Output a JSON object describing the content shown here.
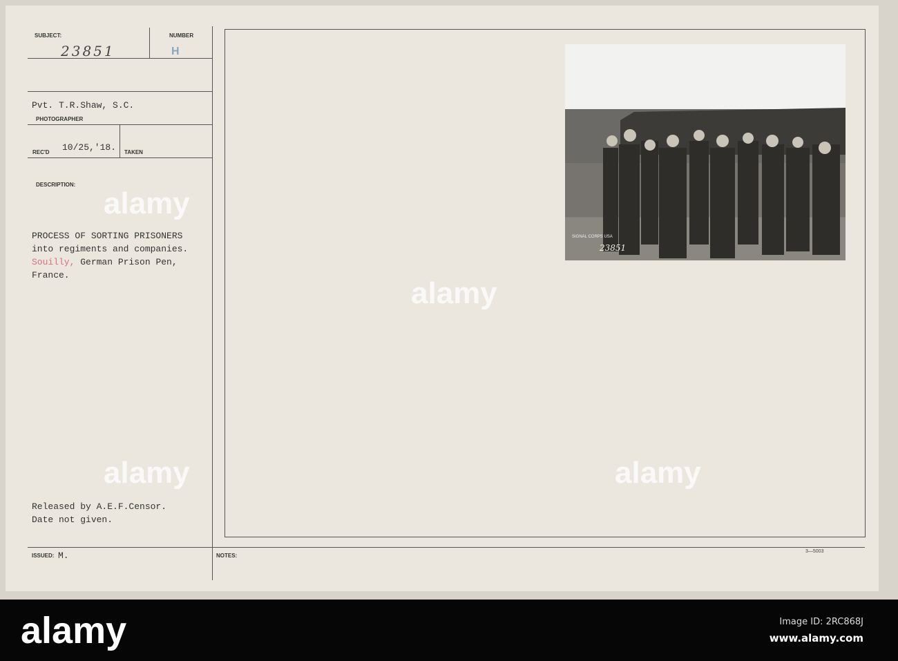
{
  "card": {
    "subject_label": "SUBJECT:",
    "subject_number": "23851",
    "number_label": "NUMBER",
    "number_stamp": "H",
    "photographer": "Pvt. T.R.Shaw, S.C.",
    "photographer_label": "PHOTOGRAPHER",
    "recd_label": "REC'D",
    "recd_date": "10/25,'18.",
    "taken_label": "TAKEN",
    "description_label": "DESCRIPTION:",
    "description_line1": "PROCESS OF SORTING PRISONERS",
    "description_line2": "into regiments and companies.",
    "description_place": "Souilly,",
    "description_line3_rest": " German Prison Pen,",
    "description_line4": "France.",
    "release_line1": "Released by A.E.F.Censor.",
    "release_line2": "Date not given.",
    "issued_label": "ISSUED:",
    "issued_value": "M.",
    "notes_label": "NOTES:",
    "form_number": "3—5003",
    "photo_stamp": "SIGNAL CORPS USA",
    "photo_number": "23851"
  },
  "watermark": {
    "text": "alamy"
  },
  "footer": {
    "logo": "alamy",
    "image_id": "Image ID: 2RC868J",
    "url": "www.alamy.com"
  },
  "colors": {
    "paper": "#ebe7df",
    "place_red": "#d9707a"
  }
}
